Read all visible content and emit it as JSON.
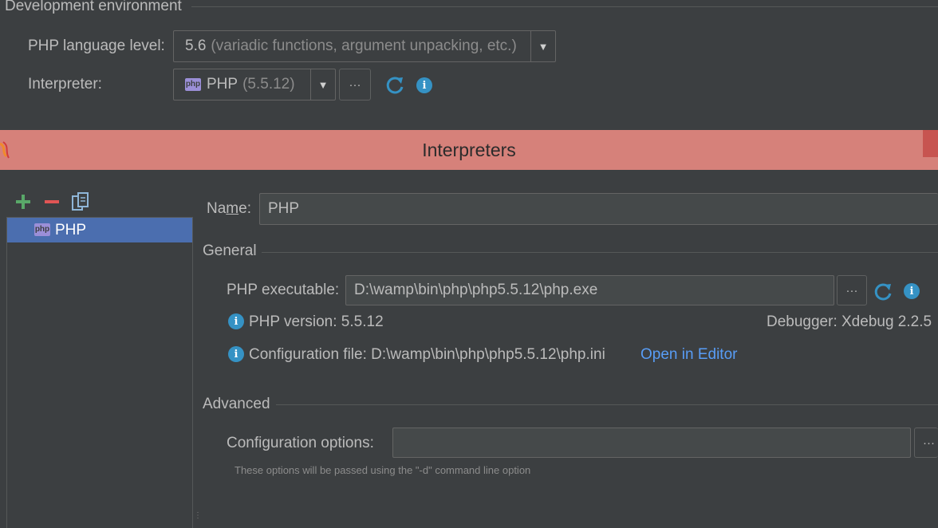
{
  "dev_env": {
    "section_title": "Development environment",
    "php_language_level_label": "PHP language level:",
    "php_language_level_value": "5.6",
    "php_language_level_hint": "(variadic functions, argument unpacking, etc.)",
    "interpreter_label": "Interpreter:",
    "interpreter_badge": "php",
    "interpreter_value": "PHP",
    "interpreter_version": "(5.5.12)",
    "browse_button": "···"
  },
  "dialog": {
    "title": "Interpreters",
    "list": [
      {
        "badge": "php",
        "label": "PHP"
      }
    ],
    "name_label_pre": "Na",
    "name_label_mnemonic": "m",
    "name_label_post": "e:",
    "name_value": "PHP",
    "general": {
      "section_title": "General",
      "executable_label": "PHP executable:",
      "executable_value": "D:\\wamp\\bin\\php\\php5.5.12\\php.exe",
      "browse_button": "···",
      "php_version_text": "PHP version: 5.5.12",
      "debugger_text": "Debugger: Xdebug 2.2.5",
      "config_file_text": "Configuration file: D:\\wamp\\bin\\php\\php5.5.12\\php.ini",
      "open_in_editor": "Open in Editor"
    },
    "advanced": {
      "section_title": "Advanced",
      "config_options_label": "Configuration options:",
      "config_options_value": "",
      "browse_button": "···",
      "hint": "These options will be passed using the \"-d\" command line option"
    }
  },
  "colors": {
    "background": "#3c3f41",
    "title_bar": "#d6817a",
    "selection": "#4b6eaf",
    "link": "#589df6",
    "add": "#59a869",
    "remove": "#e05555",
    "info": "#3592c4"
  },
  "icons": {
    "add": "add-icon",
    "remove": "remove-icon",
    "copy": "copy-icon",
    "refresh": "refresh-icon",
    "info": "info-icon",
    "app": "app-logo-icon"
  }
}
